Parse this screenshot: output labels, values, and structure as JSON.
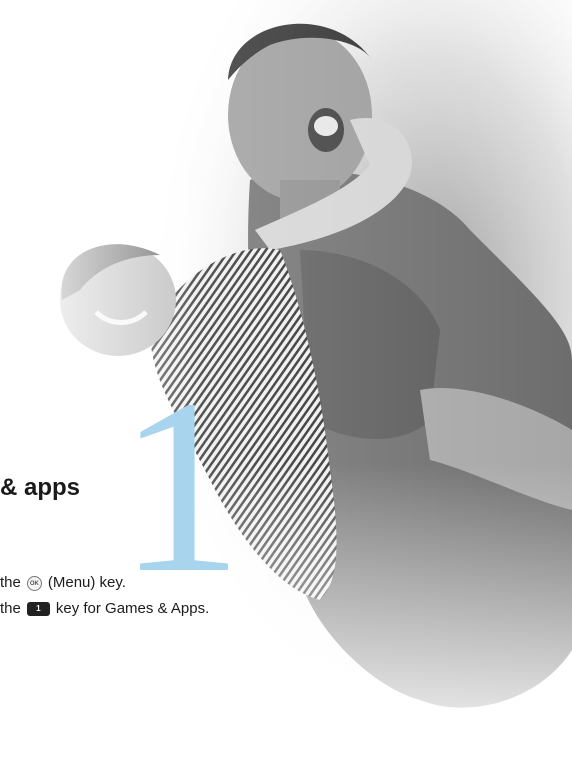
{
  "chapter": {
    "number": "1",
    "title": "& apps"
  },
  "steps": [
    {
      "prefix": "the",
      "key_icon": "ok-menu-key-icon",
      "key_glyph": "OK",
      "suffix": "(Menu) key."
    },
    {
      "prefix": "the",
      "key_icon": "one-key-icon",
      "key_glyph": "1",
      "suffix": "key for Games & Apps."
    }
  ],
  "colors": {
    "chapter_number": "#a9d4ee",
    "text": "#1c1c1c"
  }
}
